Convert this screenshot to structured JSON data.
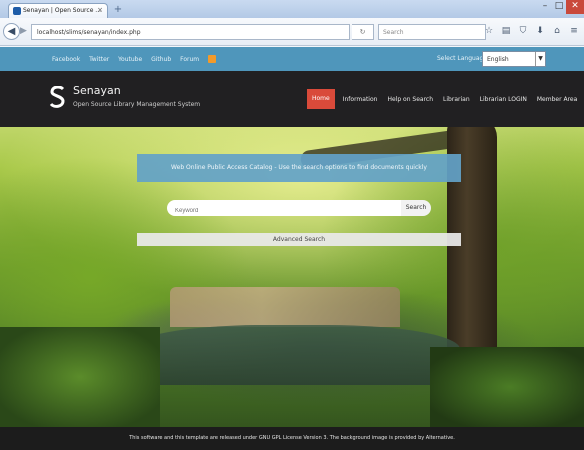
{
  "browser": {
    "tab_title": "Senayan | Open Source ...",
    "tab_close": "×",
    "new_tab": "+",
    "url": "localhost/slims/senayan/index.php",
    "search_placeholder": "Search",
    "window_controls": {
      "minimize": "–",
      "maximize": "□",
      "close": "✕"
    },
    "icons": [
      "star-icon",
      "bookmarks-icon",
      "shield-icon",
      "download-icon",
      "home-icon",
      "menu-icon"
    ]
  },
  "topbar": {
    "links": [
      "Facebook",
      "Twitter",
      "Youtube",
      "Github",
      "Forum"
    ],
    "language_label": "Select Language :",
    "language_value": "English"
  },
  "header": {
    "brand": "Senayan",
    "tagline": "Open Source Library Management System",
    "menu": [
      "Home",
      "Information",
      "Help on Search",
      "Librarian",
      "Librarian LOGIN",
      "Member Area"
    ]
  },
  "search": {
    "heading": "Web Online Public Access Catalog - Use the search options to find documents quickly",
    "placeholder": "Keyword",
    "button": "Search",
    "advanced": "Advanced Search"
  },
  "footer": {
    "text": "This software and this template are released under GNU GPL License Version 3. The background image is provided by Alternative."
  },
  "colors": {
    "topbar": "#4f96bb",
    "header": "#212022",
    "active_menu": "#d94a3a",
    "search_panel": "#63a2c8"
  }
}
